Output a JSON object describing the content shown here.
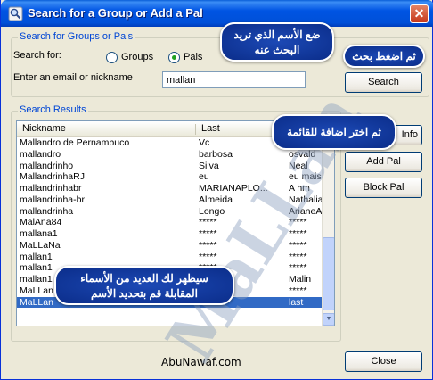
{
  "window": {
    "title": "Search for a Group or Add a Pal",
    "close_glyph": "✕"
  },
  "search_group": {
    "label": "Search for Groups or Pals",
    "search_for_label": "Search for:",
    "options": [
      {
        "label": "Groups",
        "selected": false
      },
      {
        "label": "Pals",
        "selected": true
      }
    ],
    "email_label": "Enter an email or nickname",
    "input_value": "mallan",
    "search_button": "Search"
  },
  "results": {
    "label": "Search Results",
    "columns": [
      "Nickname",
      "Last",
      ""
    ],
    "rows": [
      [
        "Mallandro de Pernambuco",
        "Vc",
        ""
      ],
      [
        "mallandro",
        "barbosa",
        "osvald"
      ],
      [
        "mallandrinho",
        "Silva",
        "Neal"
      ],
      [
        "MallandrinhaRJ",
        "eu",
        "eu mais"
      ],
      [
        "mallandrinhabr",
        "MARIANAPLO...",
        "A hm"
      ],
      [
        "mallandrinha-br",
        "Almeida",
        "Nathalia"
      ],
      [
        "mallandrinha",
        "Longo",
        "ArianeA..."
      ],
      [
        "MalAna84",
        "*****",
        "*****"
      ],
      [
        "mallana1",
        "*****",
        "*****"
      ],
      [
        "MaLLaNa",
        "*****",
        "*****"
      ],
      [
        "mallan1",
        "*****",
        "*****"
      ],
      [
        "mallan1",
        "*****",
        "*****"
      ],
      [
        "mallan1",
        "*****",
        "Malin"
      ],
      [
        "MaLLan",
        "*****",
        "*****"
      ],
      [
        "MaLLan",
        "hacker",
        "last"
      ]
    ],
    "selected_index": 14
  },
  "side_buttons": [
    "Info",
    "Add Pal",
    "Block Pal"
  ],
  "close_button": "Close",
  "footer_text": "AbuNawaf.com",
  "callouts": {
    "put_name": "ضع الأسم الذي تريد البحث عنه",
    "press_search": "ثم اضغط بحث",
    "choose_add": "ثم اختر اضافة للقائمة",
    "many_names": "سيظهر لك العديد من الأسماء المقابلة قم بتحديد الأسم"
  },
  "watermark_text": "MaLLan",
  "icons": {
    "title": "search-icon",
    "close": "close-icon",
    "scroll_up": "scroll-up-icon",
    "scroll_down": "scroll-down-icon"
  },
  "colors": {
    "title_bar": "#0054e3",
    "group_label": "#0046d5",
    "selection": "#316ac5",
    "callout": "#0b2d8a"
  }
}
